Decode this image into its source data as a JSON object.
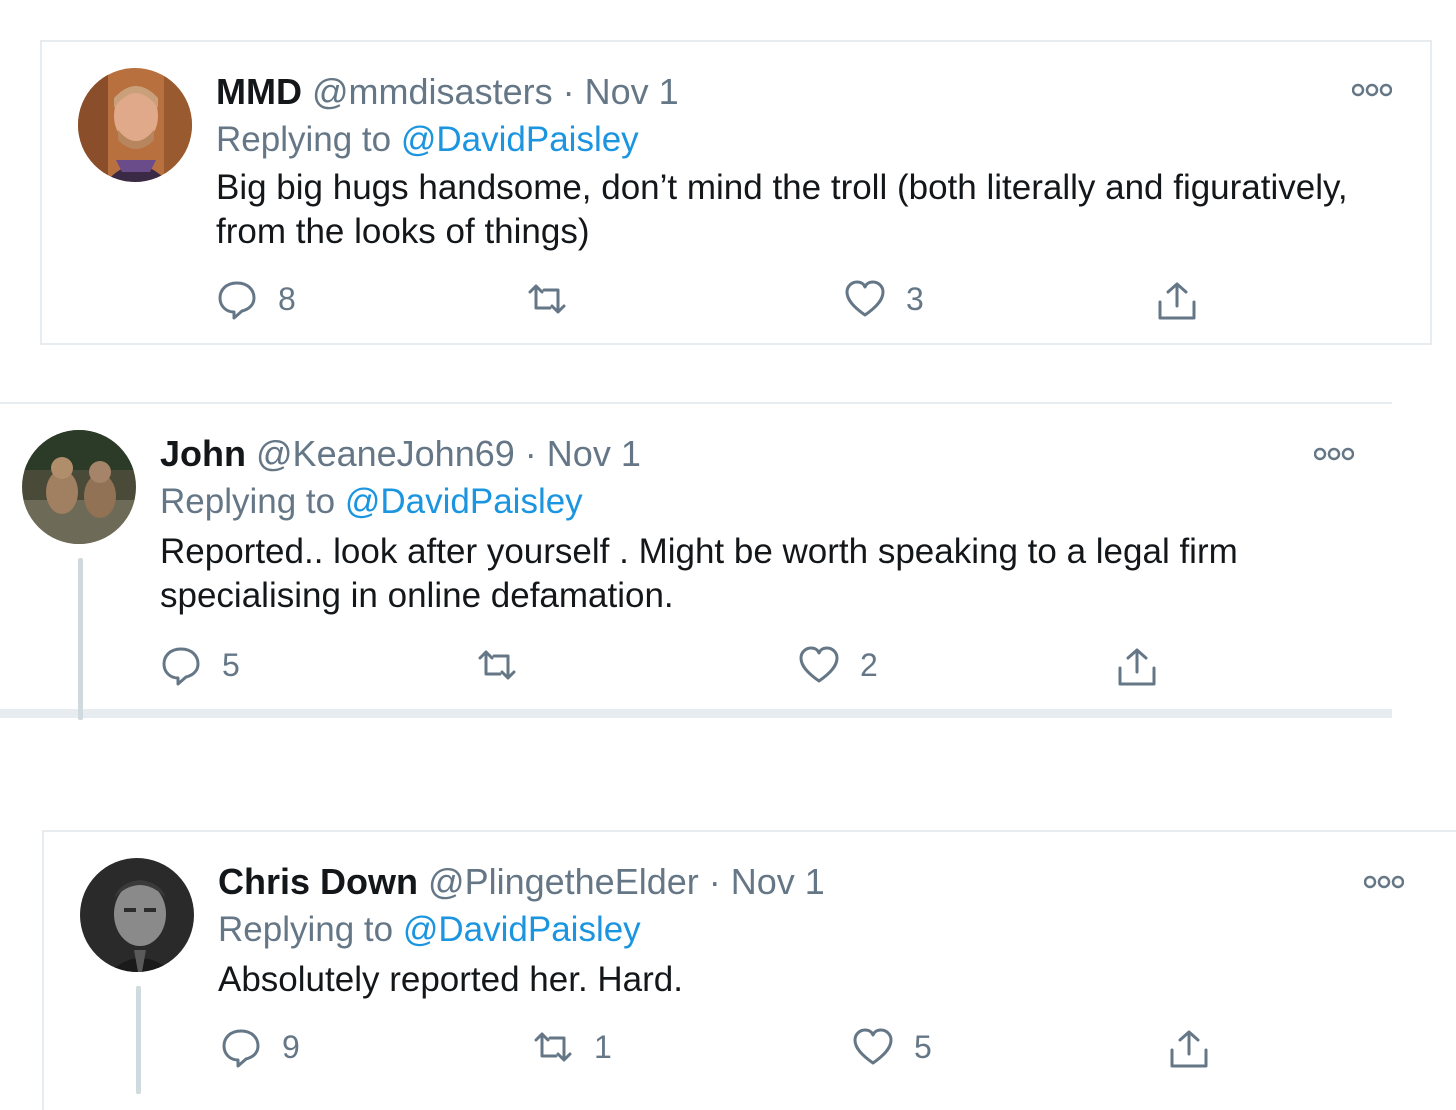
{
  "tweets": [
    {
      "name": "MMD",
      "handle": "@mmdisasters",
      "separator": "·",
      "date": "Nov 1",
      "replying_prefix": "Replying to",
      "replying_to": "@DavidPaisley",
      "text": "Big big hugs handsome, don’t mind the troll (both literally and figuratively, from the looks of things)",
      "replies": "8",
      "retweets": "",
      "likes": "3"
    },
    {
      "name": "John",
      "handle": "@KeaneJohn69",
      "separator": "·",
      "date": "Nov 1",
      "replying_prefix": "Replying to",
      "replying_to": "@DavidPaisley",
      "text": "Reported.. look after yourself . Might be worth speaking to a legal firm specialising in online defamation.",
      "replies": "5",
      "retweets": "",
      "likes": "2"
    },
    {
      "name": "Chris Down",
      "handle": "@PlingetheElder",
      "separator": "·",
      "date": "Nov 1",
      "replying_prefix": "Replying to",
      "replying_to": "@DavidPaisley",
      "text": "Absolutely reported her. Hard.",
      "replies": "9",
      "retweets": "1",
      "likes": "5"
    }
  ],
  "icons": {
    "reply": "speech-bubble",
    "retweet": "retweet-arrows",
    "like": "heart",
    "share": "upload-arrow",
    "more": "three-dots"
  },
  "colors": {
    "link": "#1b95e0",
    "secondary_text": "#657786",
    "border": "#e6ecf0"
  }
}
